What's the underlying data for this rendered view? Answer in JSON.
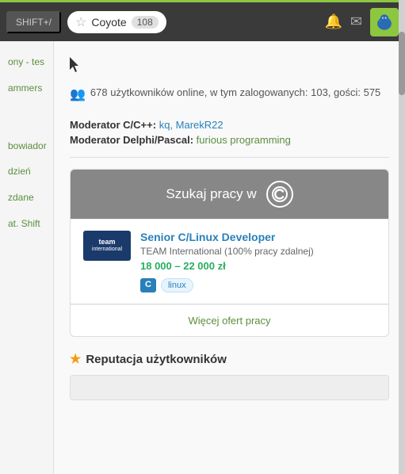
{
  "topbar": {
    "shift_label": "SHIFT+/",
    "coyote_label": "Coyote",
    "coyote_count": "108",
    "bell_icon": "🔔",
    "mail_icon": "✉",
    "star_icon": "☆"
  },
  "online": {
    "icon": "👥",
    "text": "678 użytkowników online, w tym zalogowanych: 103, gości: 575"
  },
  "moderators": {
    "cpp_label": "Moderator C/C++:",
    "cpp_names": "kq, MarekR22",
    "delphi_label": "Moderator Delphi/Pascal:",
    "delphi_name": "furious programming"
  },
  "job_box": {
    "header_text": "Szukaj pracy w",
    "c_logo": "©",
    "job_title": "Senior C/Linux Developer",
    "company_name": "TEAM International (100% pracy zdalnej)",
    "company_logo_line1": "team",
    "company_logo_line2": "international",
    "salary": "18 000 – 22 000 zł",
    "tag_c": "C",
    "tag_linux": "linux",
    "more_link": "Więcej ofert pracy"
  },
  "reputation": {
    "label": "Reputacja użytkowników"
  },
  "sidebar": {
    "item1": "ony - tes",
    "item2": "ammers",
    "item3": "bowiador",
    "item4": "dzień",
    "item5": "zdane",
    "item6": "at. Shift"
  }
}
